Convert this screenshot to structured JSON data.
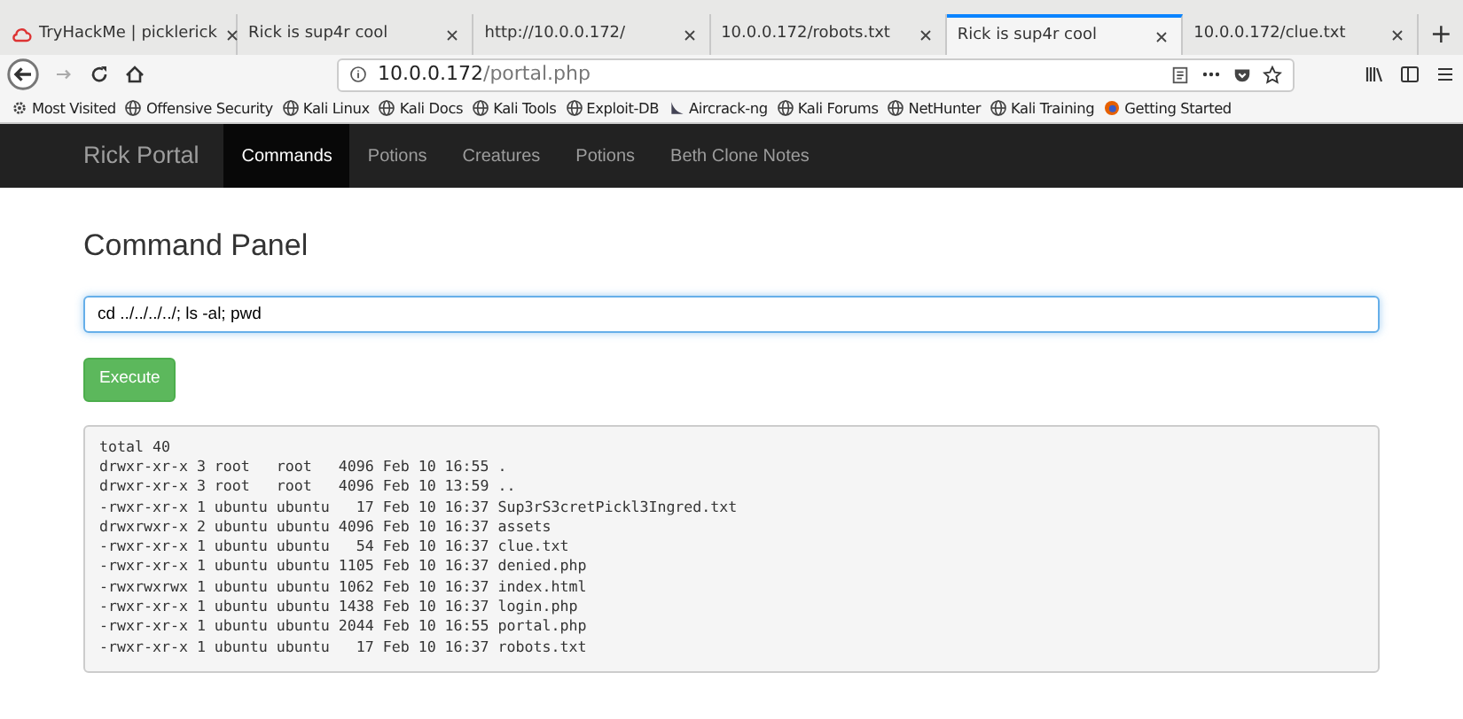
{
  "browser": {
    "tabs": [
      {
        "title": "TryHackMe | picklerick",
        "selected": false,
        "icon": true
      },
      {
        "title": "Rick is sup4r cool",
        "selected": false,
        "icon": false
      },
      {
        "title": "http://10.0.0.172/",
        "selected": false,
        "icon": false
      },
      {
        "title": "10.0.0.172/robots.txt",
        "selected": false,
        "icon": false
      },
      {
        "title": "Rick is sup4r cool",
        "selected": true,
        "icon": false
      },
      {
        "title": "10.0.0.172/clue.txt",
        "selected": false,
        "icon": false
      }
    ],
    "new_tab": "+",
    "address": {
      "host": "10.0.0.172",
      "path": "/portal.php"
    },
    "bookmarks": [
      {
        "label": "Most Visited",
        "kind": "gear"
      },
      {
        "label": "Offensive Security",
        "kind": "globe"
      },
      {
        "label": "Kali Linux",
        "kind": "globe"
      },
      {
        "label": "Kali Docs",
        "kind": "globe"
      },
      {
        "label": "Kali Tools",
        "kind": "globe"
      },
      {
        "label": "Exploit-DB",
        "kind": "globe"
      },
      {
        "label": "Aircrack-ng",
        "kind": "dish"
      },
      {
        "label": "Kali Forums",
        "kind": "globe"
      },
      {
        "label": "NetHunter",
        "kind": "globe"
      },
      {
        "label": "Kali Training",
        "kind": "globe"
      },
      {
        "label": "Getting Started",
        "kind": "firefox"
      }
    ]
  },
  "navbar": {
    "brand": "Rick Portal",
    "items": [
      {
        "label": "Commands",
        "selected": true
      },
      {
        "label": "Potions",
        "selected": false
      },
      {
        "label": "Creatures",
        "selected": false
      },
      {
        "label": "Potions",
        "selected": false
      },
      {
        "label": "Beth Clone Notes",
        "selected": false
      }
    ]
  },
  "panel": {
    "title": "Command Panel",
    "command": "cd ../../../../; ls -al; pwd",
    "button": "Execute",
    "output": [
      "total 40",
      "drwxr-xr-x 3 root   root   4096 Feb 10 16:55 .",
      "drwxr-xr-x 3 root   root   4096 Feb 10 13:59 ..",
      "-rwxr-xr-x 1 ubuntu ubuntu   17 Feb 10 16:37 Sup3rS3cretPickl3Ingred.txt",
      "drwxrwxr-x 2 ubuntu ubuntu 4096 Feb 10 16:37 assets",
      "-rwxr-xr-x 1 ubuntu ubuntu   54 Feb 10 16:37 clue.txt",
      "-rwxr-xr-x 1 ubuntu ubuntu 1105 Feb 10 16:37 denied.php",
      "-rwxrwxrwx 1 ubuntu ubuntu 1062 Feb 10 16:37 index.html",
      "-rwxr-xr-x 1 ubuntu ubuntu 1438 Feb 10 16:37 login.php",
      "-rwxr-xr-x 1 ubuntu ubuntu 2044 Feb 10 16:55 portal.php",
      "-rwxr-xr-x 1 ubuntu ubuntu   17 Feb 10 16:37 robots.txt"
    ]
  }
}
